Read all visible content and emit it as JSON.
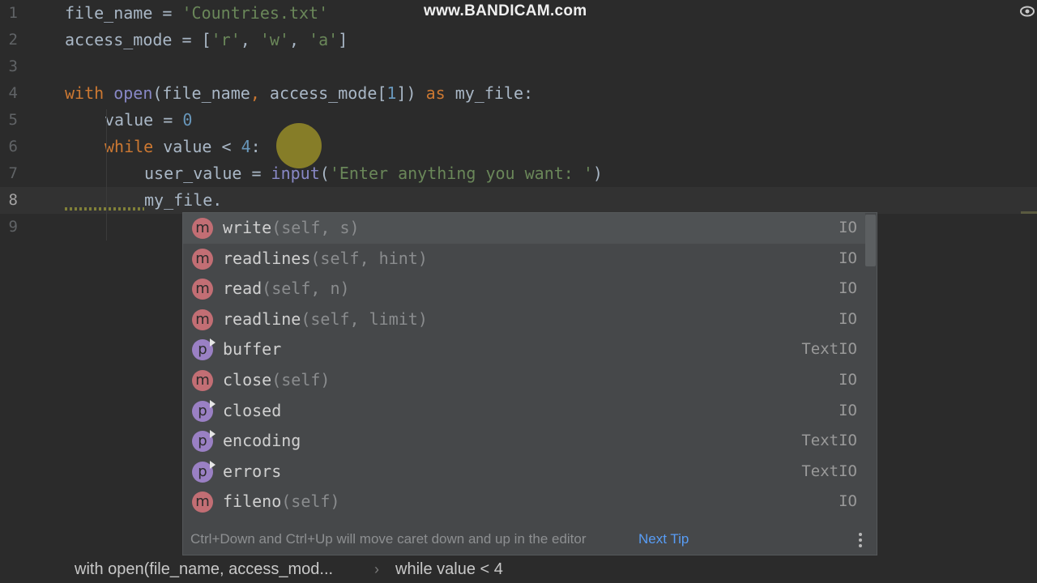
{
  "watermark": "www.BANDICAM.com",
  "editor": {
    "line_numbers": [
      "1",
      "2",
      "3",
      "4",
      "5",
      "6",
      "7",
      "8",
      "9"
    ],
    "line1": {
      "var": "file_name",
      "eq": " = ",
      "str": "'Countries.txt'"
    },
    "line2": {
      "var": "access_mode",
      "eq": " = [",
      "s1": "'r'",
      "c1": ", ",
      "s2": "'w'",
      "c2": ", ",
      "s3": "'a'",
      "end": "]"
    },
    "line4": {
      "kw1": "with",
      "sp1": " ",
      "fn": "open",
      "args1": "(file_name",
      "comma": ", ",
      "args2": "access_mode[",
      "num": "1",
      "args3": "]) ",
      "kw2": "as",
      "rest": " my_file:"
    },
    "line5": {
      "text": "value = ",
      "num": "0"
    },
    "line6": {
      "kw": "while",
      "text": " value < ",
      "num": "4",
      "end": ":"
    },
    "line7": {
      "text": "user_value = ",
      "fn": "input",
      "open": "(",
      "str": "'Enter anything you want: '",
      "close": ")"
    },
    "line8": {
      "text": "my_file."
    }
  },
  "completion": {
    "items": [
      {
        "badge": "m",
        "name": "write",
        "sig": "(self, s)",
        "type": "IO"
      },
      {
        "badge": "m",
        "name": "readlines",
        "sig": "(self, hint)",
        "type": "IO"
      },
      {
        "badge": "m",
        "name": "read",
        "sig": "(self, n)",
        "type": "IO"
      },
      {
        "badge": "m",
        "name": "readline",
        "sig": "(self, limit)",
        "type": "IO"
      },
      {
        "badge": "p",
        "name": "buffer",
        "sig": "",
        "type": "TextIO"
      },
      {
        "badge": "m",
        "name": "close",
        "sig": "(self)",
        "type": "IO"
      },
      {
        "badge": "p",
        "name": "closed",
        "sig": "",
        "type": "IO"
      },
      {
        "badge": "p",
        "name": "encoding",
        "sig": "",
        "type": "TextIO"
      },
      {
        "badge": "p",
        "name": "errors",
        "sig": "",
        "type": "TextIO"
      },
      {
        "badge": "m",
        "name": "fileno",
        "sig": "(self)",
        "type": "IO"
      }
    ],
    "hint": "Ctrl+Down and Ctrl+Up will move caret down and up in the editor",
    "next_tip": "Next Tip"
  },
  "breadcrumb": {
    "item1": "with open(file_name, access_mod...",
    "separator": "›",
    "item2": "while value < 4"
  },
  "colors": {
    "background": "#2b2b2b",
    "keyword": "#cc7832",
    "string": "#6a8759",
    "number": "#6897bb",
    "link": "#589df6"
  }
}
